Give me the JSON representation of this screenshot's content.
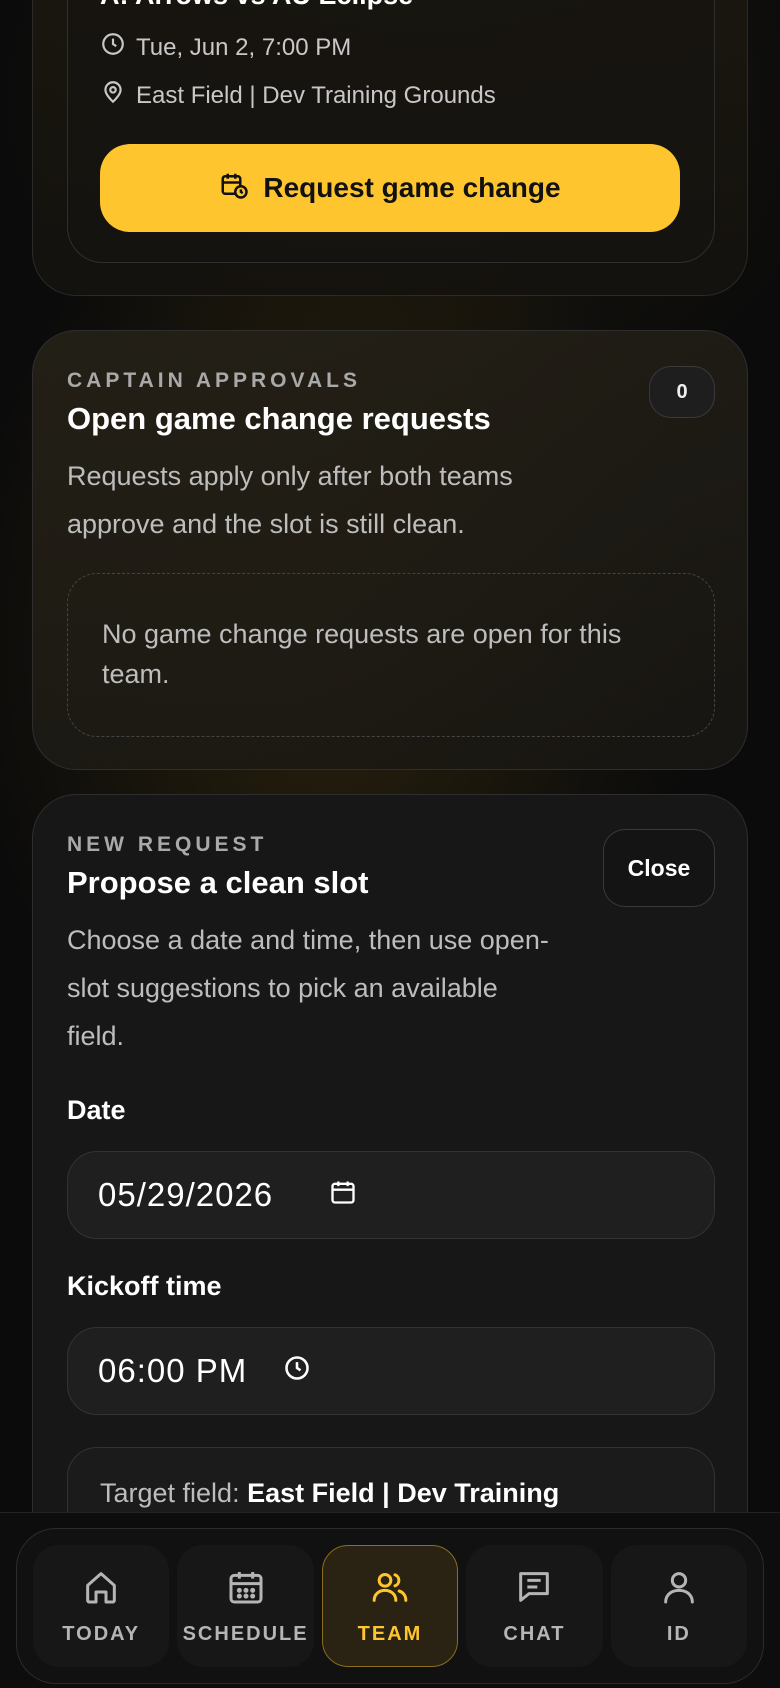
{
  "match": {
    "title": "A: Arrows vs AU Eclipse",
    "datetime": "Tue, Jun 2, 7:00 PM",
    "location": "East Field | Dev Training Grounds",
    "request_button": "Request game change"
  },
  "approvals": {
    "eyebrow": "CAPTAIN APPROVALS",
    "title": "Open game change requests",
    "description_line1": "Requests apply only after both teams",
    "description_line2": "approve and the slot is still clean.",
    "count": "0",
    "empty_line1": "No game change requests are open for this",
    "empty_line2": "team."
  },
  "new_request": {
    "eyebrow": "NEW REQUEST",
    "title": "Propose a clean slot",
    "close_label": "Close",
    "description_line1": "Choose a date and time, then use open-",
    "description_line2": "slot suggestions to pick an available",
    "description_line3": "field.",
    "date_label": "Date",
    "date_value": "05/29/2026",
    "time_label": "Kickoff time",
    "time_value": "06:00 PM",
    "target_label": "Target field:",
    "target_value": "East Field | Dev Training"
  },
  "nav": {
    "items": [
      {
        "label": "TODAY",
        "icon": "home-icon"
      },
      {
        "label": "SCHEDULE",
        "icon": "calendar-icon"
      },
      {
        "label": "TEAM",
        "icon": "users-icon"
      },
      {
        "label": "CHAT",
        "icon": "chat-icon"
      },
      {
        "label": "ID",
        "icon": "user-icon"
      }
    ],
    "active": "TEAM"
  },
  "colors": {
    "accent": "#fec52e",
    "background": "#0b0b0b",
    "card": "#171717"
  }
}
